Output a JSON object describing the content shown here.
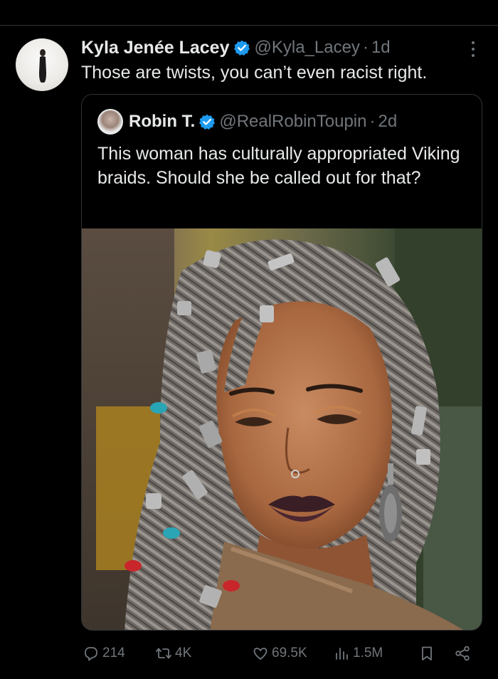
{
  "post": {
    "author_name": "Kyla Jenée Lacey",
    "author_handle": "@Kyla_Lacey",
    "separator": "·",
    "time": "1d",
    "text": "Those are twists, you can’t even racist right."
  },
  "quoted_post": {
    "author_name": "Robin T.",
    "author_handle": "@RealRobinToupin",
    "separator": "·",
    "time": "2d",
    "text": "This woman has culturally appropriated Viking braids. Should she be called out for that?"
  },
  "actions": {
    "replies": "214",
    "reposts": "4K",
    "likes": "69.5K",
    "views": "1.5M"
  },
  "icons": {
    "verified": "verified-badge-icon",
    "more": "more-options-icon",
    "reply": "reply-icon",
    "repost": "repost-icon",
    "like": "heart-icon",
    "views": "views-chart-icon",
    "bookmark": "bookmark-icon",
    "share": "share-icon"
  },
  "colors": {
    "background": "#000000",
    "text_primary": "#e7e9ea",
    "text_secondary": "#71767b",
    "verified_blue": "#1d9bf0",
    "border": "#2f3336"
  }
}
